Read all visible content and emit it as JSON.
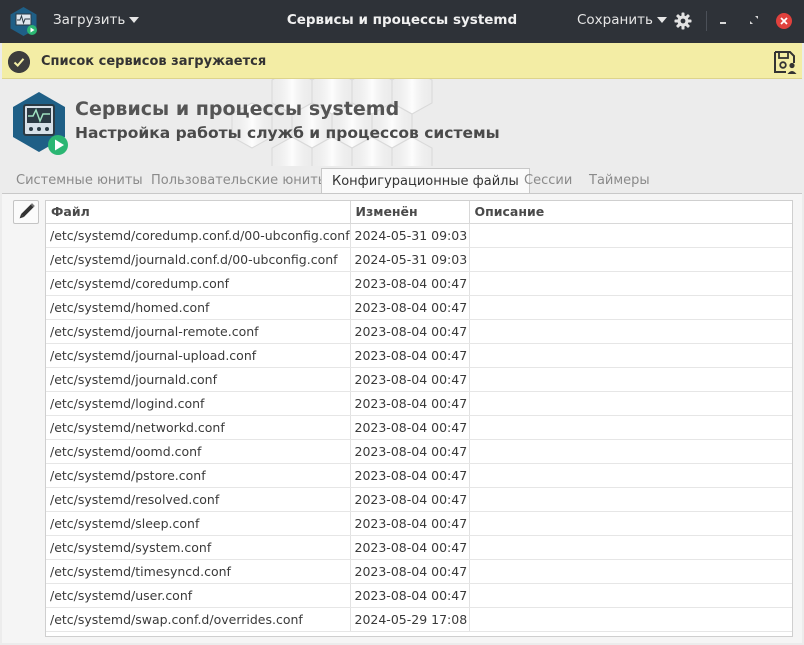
{
  "titlebar": {
    "load_label": "Загрузить",
    "title": "Сервисы и процессы systemd",
    "save_label": "Сохранить"
  },
  "notification": {
    "text": "Список сервисов загружается"
  },
  "header": {
    "title": "Сервисы и процессы systemd",
    "subtitle": "Настройка работы служб и процессов системы"
  },
  "tabs": [
    {
      "label": "Системные юниты",
      "active": false
    },
    {
      "label": "Пользовательские юниты",
      "active": false
    },
    {
      "label": "Конфигурационные файлы",
      "active": true
    },
    {
      "label": "Сессии",
      "active": false
    },
    {
      "label": "Таймеры",
      "active": false
    }
  ],
  "table": {
    "columns": [
      "Файл",
      "Изменён",
      "Описание"
    ],
    "rows": [
      [
        "/etc/systemd/coredump.conf.d/00-ubconfig.conf",
        "2024-05-31 09:03",
        ""
      ],
      [
        "/etc/systemd/journald.conf.d/00-ubconfig.conf",
        "2024-05-31 09:03",
        ""
      ],
      [
        "/etc/systemd/coredump.conf",
        "2023-08-04 00:47",
        ""
      ],
      [
        "/etc/systemd/homed.conf",
        "2023-08-04 00:47",
        ""
      ],
      [
        "/etc/systemd/journal-remote.conf",
        "2023-08-04 00:47",
        ""
      ],
      [
        "/etc/systemd/journal-upload.conf",
        "2023-08-04 00:47",
        ""
      ],
      [
        "/etc/systemd/journald.conf",
        "2023-08-04 00:47",
        ""
      ],
      [
        "/etc/systemd/logind.conf",
        "2023-08-04 00:47",
        ""
      ],
      [
        "/etc/systemd/networkd.conf",
        "2023-08-04 00:47",
        ""
      ],
      [
        "/etc/systemd/oomd.conf",
        "2023-08-04 00:47",
        ""
      ],
      [
        "/etc/systemd/pstore.conf",
        "2023-08-04 00:47",
        ""
      ],
      [
        "/etc/systemd/resolved.conf",
        "2023-08-04 00:47",
        ""
      ],
      [
        "/etc/systemd/sleep.conf",
        "2023-08-04 00:47",
        ""
      ],
      [
        "/etc/systemd/system.conf",
        "2023-08-04 00:47",
        ""
      ],
      [
        "/etc/systemd/timesyncd.conf",
        "2023-08-04 00:47",
        ""
      ],
      [
        "/etc/systemd/user.conf",
        "2023-08-04 00:47",
        ""
      ],
      [
        "/etc/systemd/swap.conf.d/overrides.conf",
        "2024-05-29 17:08",
        ""
      ]
    ]
  },
  "icons": {
    "app": "app-monitor-icon",
    "gear": "gear-icon",
    "save": "save-user-icon",
    "edit": "pencil-icon",
    "check": "check-circle-icon"
  },
  "colors": {
    "titlebar": "#2e3238",
    "notification": "#f3eda5",
    "close": "#e0413d",
    "accent": "#2bb673",
    "icon_bg": "#1f5f86"
  }
}
